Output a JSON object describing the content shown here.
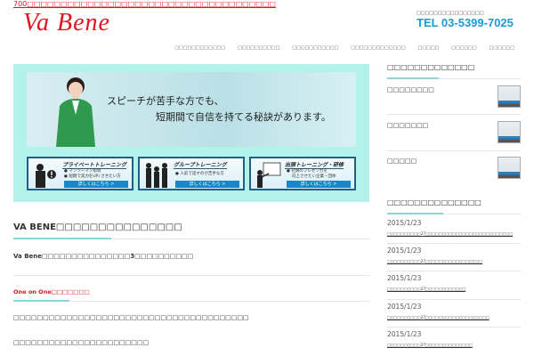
{
  "header": {
    "top_notice": "700□□□□□□□□□□□□□□□□□□□□□□□□□□□□□□□□□□□□□",
    "logo": "Va Bene",
    "tel_label": "□□□□□□□□□□□□□□□□",
    "tel": "TEL 03-5399-7025"
  },
  "nav": [
    "□□□□□□□□□□□□",
    "□□□□□□□□□□",
    "□□□□□□□□□□□",
    "□□□□□□□□□□□□□",
    "□□□□□",
    "□□□□□□",
    "□□□□□□"
  ],
  "banner": {
    "headline_1": "スピーチが苦手な方でも、",
    "headline_2": "短期間で自信を持てる秘訣があります。",
    "cards": [
      {
        "title": "プライベートトレーニング",
        "bullets": [
          "● マンツーマン指導",
          "● 短期で実力をUP♪させたい方"
        ],
        "button": "詳しくはこちら >"
      },
      {
        "title": "グループトレーニング",
        "bullets": [
          "● 人前で話すのが苦手な方"
        ],
        "button": "詳しくはこちら >"
      },
      {
        "title": "出張トレーニング・研修",
        "bullets": [
          "● 社員のプレゼン力を",
          "向上させたい企業・団体"
        ],
        "button": "詳しくはこちら >"
      }
    ]
  },
  "main": {
    "heading": "VA BENE□□□□□□□□□□□□□□□",
    "intro": "Va Bene□□□□□□□□□□□□□□□3□□□□□□□□□□",
    "subheading": "One on One□□□□□□□",
    "para1": "□□□□□□□□□□□□□□□□□□□□□□□□□□□□□□□□□□□□□□□□",
    "para2": "□□□□□□□□□□□□□□□□□□□□□□□"
  },
  "sidebar": {
    "videos_title": "□□□□□□□□□□□□□",
    "videos": [
      "□□□□□□□□",
      "□□□□□□□",
      "□□□□□"
    ],
    "news_title": "□□□□□□□□□□□□□□",
    "news": [
      {
        "date": "2015/1/23",
        "title": "□□□□□□□□□□27□□□□□□□□□□□□□□□□□□□□□□□□□□"
      },
      {
        "date": "2015/1/23",
        "title": "□□□□□□□□□□27□□□□□□□□□□□□□□□□□"
      },
      {
        "date": "2015/1/23",
        "title": "□□□□□□□□□□27□□□□□□□□□□□□"
      },
      {
        "date": "2015/1/23",
        "title": "□□□□□□□□□□27□□□□□□□□□□□□□□□□□□□"
      },
      {
        "date": "2015/1/23",
        "title": "□□□□□□□□□□27□□□□□□□□□□□□□□"
      }
    ]
  },
  "colors": {
    "brand_red": "#e0141e",
    "tel_blue": "#1a9ad6",
    "accent_teal": "#8fd6dc",
    "banner_bg": "#b3f2ea"
  }
}
